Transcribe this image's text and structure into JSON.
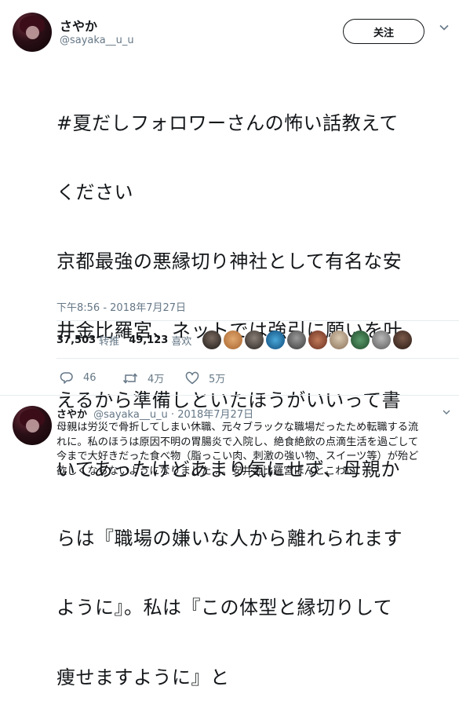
{
  "tweet": {
    "author_name": "さやか",
    "author_handle": "@sayaka__u_u",
    "follow_label": "关注",
    "lines": [
      "#夏だしフォロワーさんの怖い話教えて",
      "ください",
      "京都最強の悪縁切り神社として有名な安",
      "井金比羅宮、ネットでは強引に願いを叶",
      "えるから準備しといたほうがいいって書",
      "いてあったけどあまり気にせず、母親か",
      "らは『職場の嫌いな人から離れられます",
      "ように』。私は『この体型と縁切りして",
      "痩せますように』と"
    ],
    "timestamp": "下午8:56 - 2018年7月27日",
    "retweet_count": "37,503",
    "retweet_label": "转推",
    "like_count": "49,123",
    "like_label": "喜欢",
    "reply_action_count": "46",
    "retweet_action_count": "4万",
    "like_action_count": "5万"
  },
  "reply": {
    "author_name": "さやか",
    "author_handle_date": "@sayaka__u_u · 2018年7月27日",
    "lines": [
      "母親は労災で骨折してしまい休職、元々ブラックな職場だったため転職する流",
      "れに。私のほうは原因不明の胃腸炎で入院し、絶食絶飲の点滴生活を過ごして",
      "今まで大好きだった食べ物（脂っこい肉、刺激の強い物、スイーツ等）が殆ど",
      "欲しくならないようになりました...。安井金比羅宮ほんとこわい"
    ]
  },
  "colors": {
    "text": "#14171a",
    "secondary": "#657786",
    "divider": "#e6ecf0"
  }
}
